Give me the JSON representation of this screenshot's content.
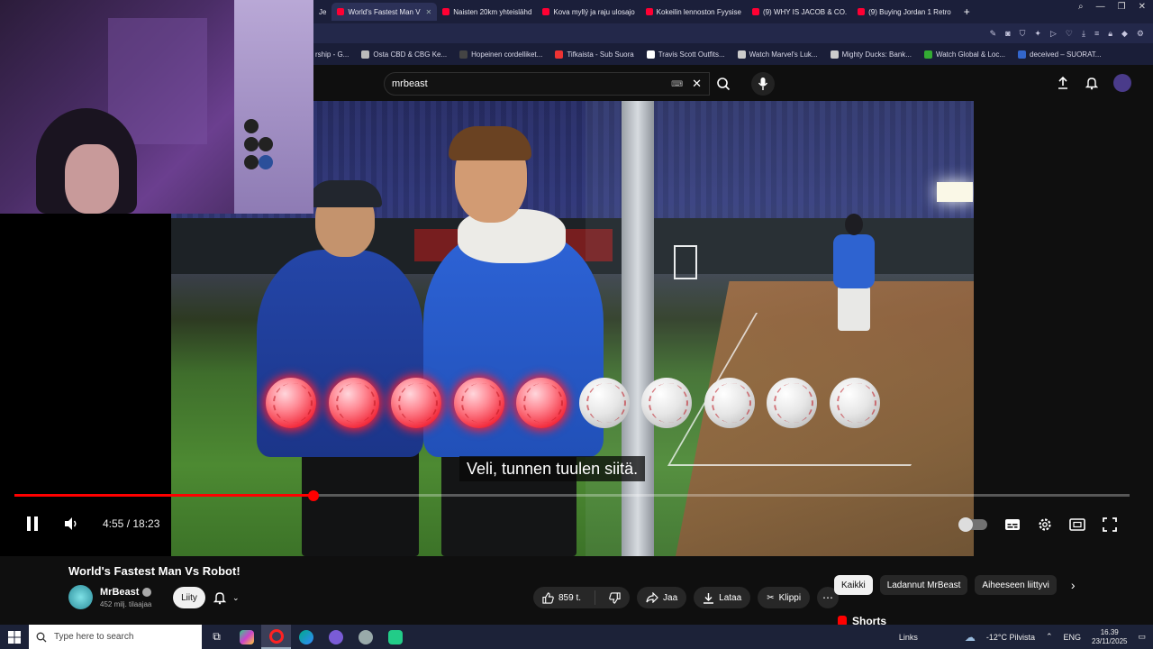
{
  "browser": {
    "tabs": [
      {
        "label": "Je",
        "active": false
      },
      {
        "label": "World's Fastest Man V",
        "active": true
      },
      {
        "label": "Naisten 20km yhteislähd",
        "active": false
      },
      {
        "label": "Kova myllý ja raju ulosajo",
        "active": false
      },
      {
        "label": "Kokeilin lennoston Fyysise",
        "active": false
      },
      {
        "label": "(9) WHY IS JACOB & CO.",
        "active": false
      },
      {
        "label": "(9) Buying Jordan 1 Retro",
        "active": false
      }
    ],
    "new_tab": "+",
    "bookmarks": [
      {
        "label": "rship - G...",
        "color": "#888"
      },
      {
        "label": "Osta CBD & CBG Ke...",
        "color": "#bbb"
      },
      {
        "label": "Hopeinen cordelliket...",
        "color": "#444"
      },
      {
        "label": "Tifkaista - Sub Suora",
        "color": "#e33"
      },
      {
        "label": "Travis Scott Outfits...",
        "color": "#fff"
      },
      {
        "label": "Watch Marvel's Luk...",
        "color": "#ccc"
      },
      {
        "label": "Mighty Ducks: Bank...",
        "color": "#ccc"
      },
      {
        "label": "Watch Global & Loc...",
        "color": "#3a3"
      },
      {
        "label": "deceived – SUORAT...",
        "color": "#36c"
      }
    ]
  },
  "header": {
    "search_value": "mrbeast",
    "keyboard_icon": "keyboard-icon",
    "clear_icon": "close-icon",
    "search_icon": "search-icon",
    "mic_icon": "mic-icon"
  },
  "player": {
    "subtitle": "Veli, tunnen tuulen siitä.",
    "time": "4:55 / 18:23",
    "progress": 0.268,
    "red_balls": 5,
    "white_balls": 5,
    "accent": "#ff0000"
  },
  "video_info": {
    "title": "World's Fastest Man Vs Robot!",
    "channel": "MrBeast",
    "subscribers": "452 milj. tilaajaa",
    "join": "Liity",
    "likes": "859 t.",
    "share": "Jaa",
    "download": "Lataa",
    "clip": "Klippi",
    "more": "⋯"
  },
  "chips": [
    "Kaikki",
    "Ladannut MrBeast",
    "Aiheeseen liittyvi"
  ],
  "shorts": "Shorts",
  "taskbar": {
    "search_placeholder": "Type here to search",
    "links": "Links",
    "weather": "-12°C  Pilvista",
    "lang": "ENG",
    "time": "16.39",
    "date": "23/11/2025"
  }
}
